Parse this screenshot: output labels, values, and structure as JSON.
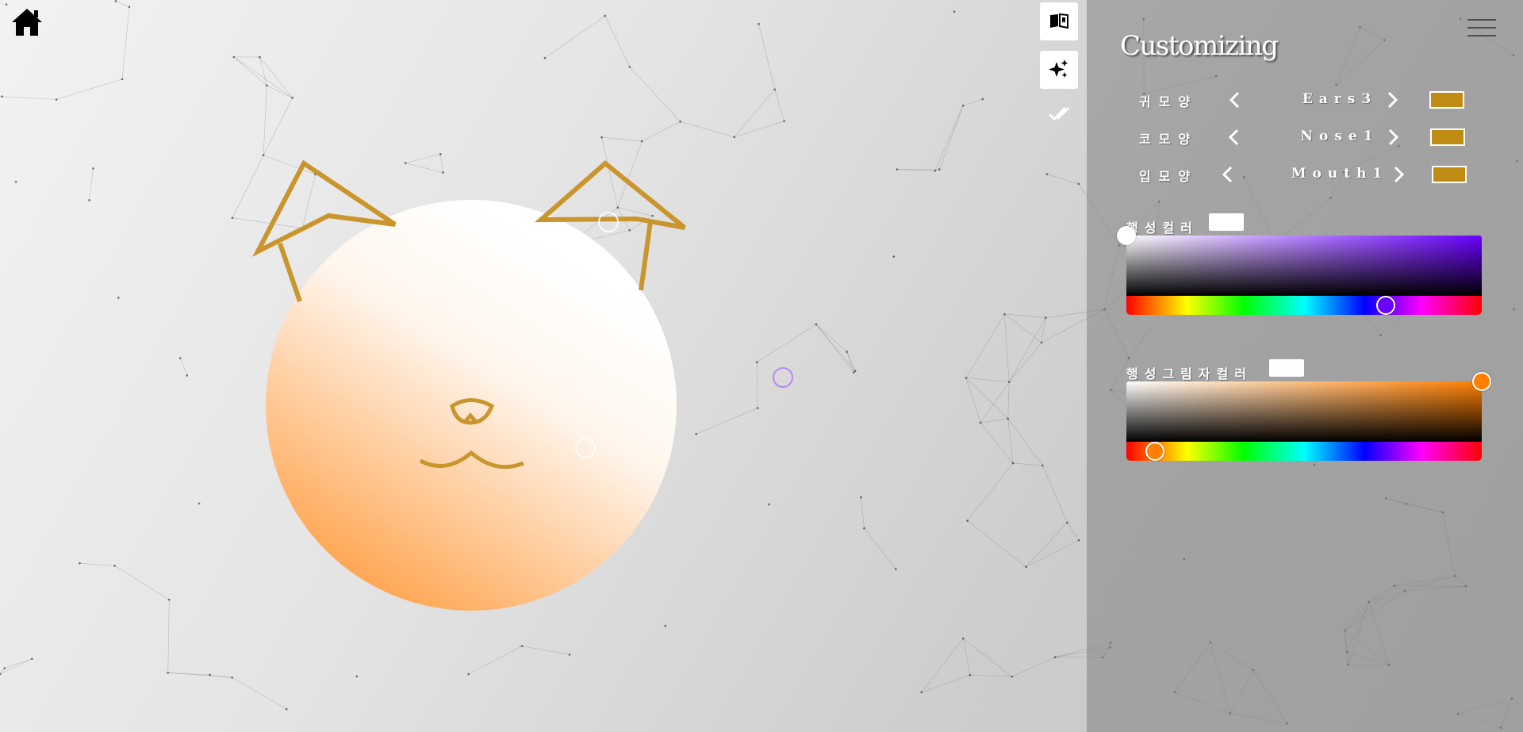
{
  "panel": {
    "title": "Customizing",
    "rows": [
      {
        "label": "귀모양",
        "value": "Ears3",
        "color": "#c08b12"
      },
      {
        "label": "코모양",
        "value": "Nose1",
        "color": "#c08b12"
      },
      {
        "label": "입모양",
        "value": "Mouth1",
        "color": "#c08b12"
      }
    ],
    "planet_color": {
      "label": "행성컬러",
      "swatch": "#ffffff",
      "hue": "#6a00ff",
      "hue_position_pct": 73,
      "handle_color": "#6a00ff"
    },
    "shadow_color": {
      "label": "행성그림자컬러",
      "swatch": "#ffffff",
      "hue": "#ff7f00",
      "hue_position_pct": 8,
      "handle_color": "#ff7f00"
    }
  },
  "icons": {
    "home": "home-icon",
    "book": "book-icon",
    "sparkle": "sparkle-icon",
    "check": "double-check-icon",
    "menu": "hamburger-menu-icon"
  },
  "character": {
    "feature_color": "#c9952c",
    "planet_light": "#ffffff",
    "planet_dark": "#ffa652"
  }
}
